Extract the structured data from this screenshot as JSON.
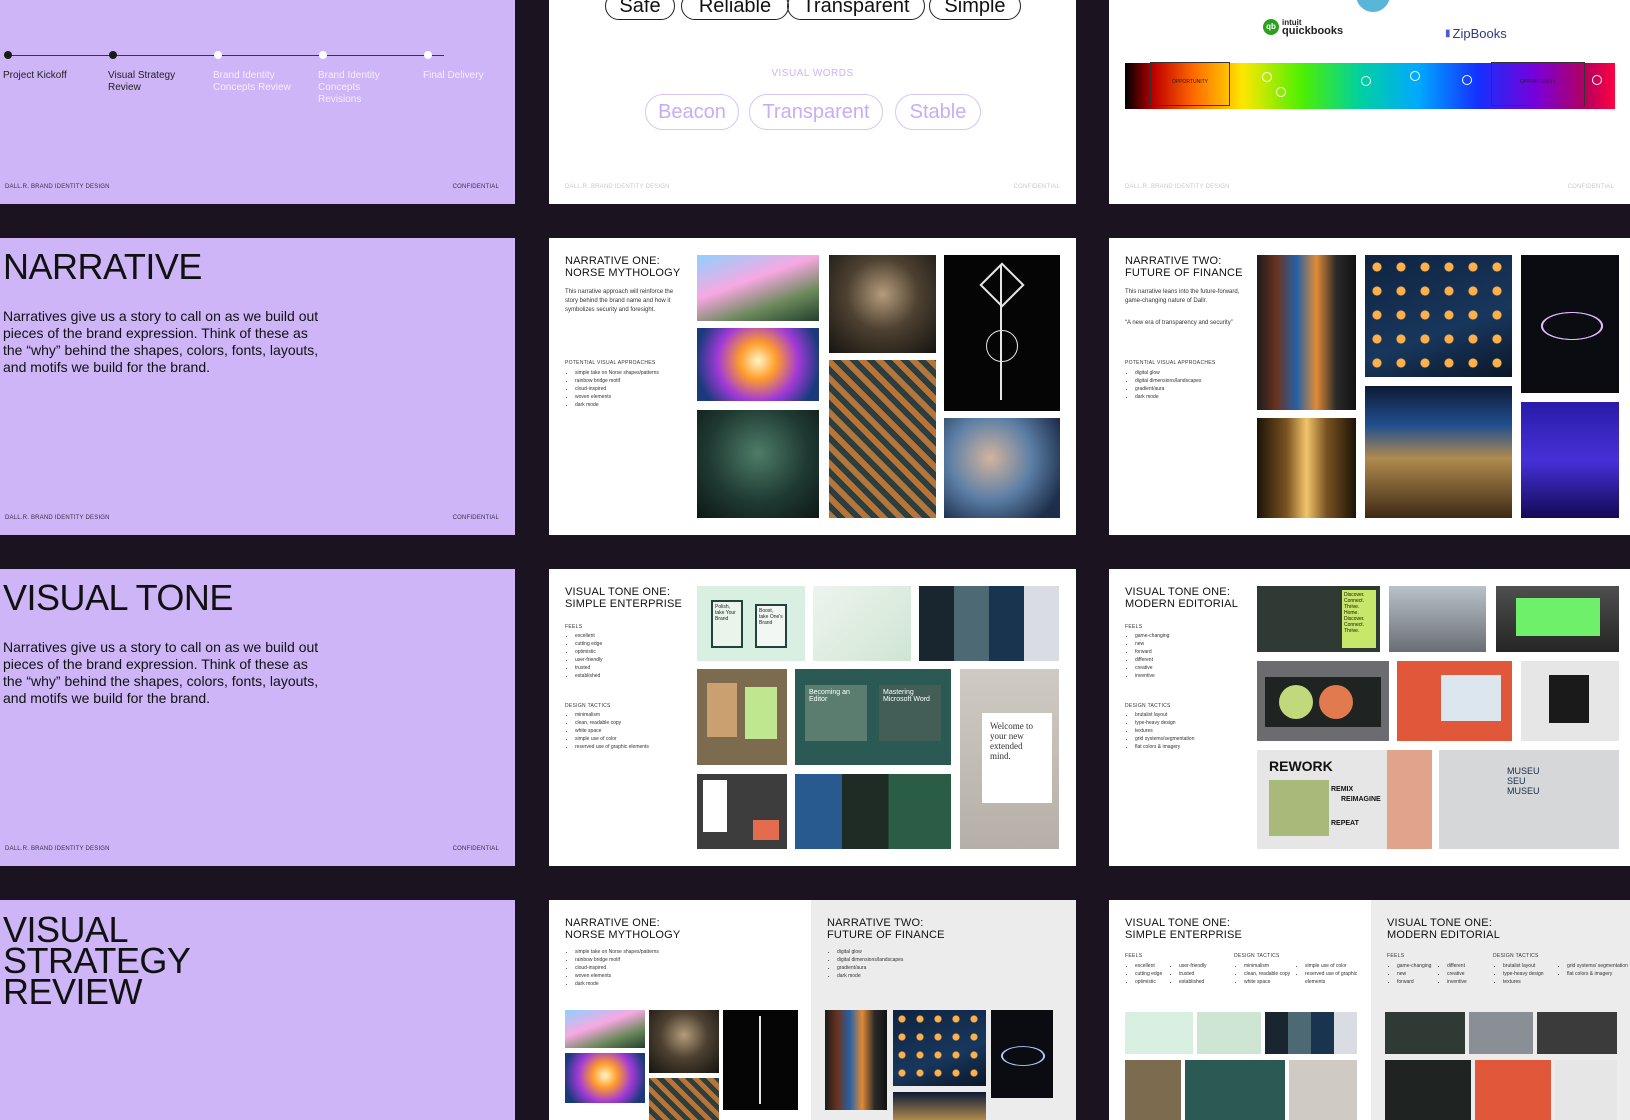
{
  "footer": {
    "left": "DALL.R. BRAND IDENTITY DESIGN",
    "right": "CONFIDENTIAL"
  },
  "timeline": {
    "steps": [
      {
        "label": "Project Kickoff",
        "done": true
      },
      {
        "label": "Visual Strategy Review",
        "done": true
      },
      {
        "label": "Brand Identity Concepts Review",
        "done": false
      },
      {
        "label": "Brand Identity Concepts Revisions",
        "done": false
      },
      {
        "label": "Final Delivery",
        "done": false
      }
    ]
  },
  "words": {
    "top_pills": [
      "Safe",
      "Reliable",
      "Transparent",
      "Simple"
    ],
    "section_label": "VISUAL WORDS",
    "pills": [
      "Beacon",
      "Transparent",
      "Stable"
    ]
  },
  "logos": {
    "quickbooks_brand": "intuit",
    "quickbooks_name": "quickbooks",
    "zipbooks": "ZipBooks",
    "opportunity_left": "OPPORTUNITY",
    "opportunity_right": "OPPORTUNITY"
  },
  "narrative": {
    "title": "NARRATIVE",
    "body": "Narratives give us a story to call on as we build out pieces of the brand expression. Think of these as the “why” behind the shapes, colors, fonts, layouts, and motifs we build for the brand."
  },
  "norse": {
    "title": "NARRATIVE ONE: NORSE MYTHOLOGY",
    "body": "This narrative approach will reinforce the story behind the brand name and how it symbolizes security and foresight.",
    "approach_label": "POTENTIAL VISUAL APPROACHES",
    "approaches": [
      "simple take on Norse shapes/patterns",
      "rainbow bridge motif",
      "cloud-inspired",
      "woven elements",
      "dark mode"
    ]
  },
  "finance": {
    "title": "NARRATIVE TWO: FUTURE OF FINANCE",
    "body": "This narrative leans into the future-forward, game-changing nature of Dallr.",
    "quote": "“A new era of transparency and security”",
    "approach_label": "POTENTIAL VISUAL APPROACHES",
    "approaches": [
      "digital glow",
      "digital dimensions/landscapes",
      "gradient/aura",
      "dark mode"
    ]
  },
  "visual_tone": {
    "title": "VISUAL TONE",
    "body": "Narratives give us a story to call on as we build out pieces of the brand expression. Think of these as the “why” behind the shapes, colors, fonts, layouts, and motifs we build for the brand."
  },
  "enterprise": {
    "title": "VISUAL TONE ONE: SIMPLE ENTERPRISE",
    "feels_label": "FEELS",
    "feels": [
      "excellent",
      "cutting edge",
      "optimistic",
      "user-friendly",
      "trusted",
      "established"
    ],
    "tactics_label": "DESIGN TACTICS",
    "tactics": [
      "minimalism",
      "clean, readable copy",
      "white space",
      "simple use of color",
      "reserved use of graphic elements"
    ],
    "billboard_1": "Polish, take Your Brand",
    "billboard_2": "Boost, take One's Brand",
    "screen_a": "Becoming an Editor",
    "screen_b": "Mastering Microsoft Word",
    "welcome": "Welcome to your new extended mind."
  },
  "editorial": {
    "title": "VISUAL TONE ONE: MODERN EDITORIAL",
    "feels_label": "FEELS",
    "feels": [
      "game-changing",
      "new",
      "forward",
      "different",
      "creative",
      "inventive"
    ],
    "tactics_label": "DESIGN TACTICS",
    "tactics": [
      "brutalist layout",
      "type-heavy design",
      "textures",
      "grid systems/segmentation",
      "flat colors & imagery"
    ],
    "poster_text": "Discover. Connect. Thrive. Home. Discover. Connect. Thrive.",
    "rework": [
      "REWORK",
      "REMIX",
      "REIMAGINE",
      "REPEAT"
    ],
    "museu": "MUSEU SEU MUSEU"
  },
  "strategy": {
    "title": "VISUAL STRATEGY REVIEW"
  },
  "bottom_norse": {
    "title": "NARRATIVE ONE: NORSE MYTHOLOGY",
    "items": [
      "simple take on Norse shapes/patterns",
      "rainbow bridge motif",
      "cloud-inspired",
      "woven elements",
      "dark mode"
    ]
  },
  "bottom_finance": {
    "title": "NARRATIVE TWO: FUTURE OF FINANCE",
    "items": [
      "digital glow",
      "digital dimensions/landscapes",
      "gradient/aura",
      "dark mode"
    ]
  },
  "bottom_enterprise": {
    "title": "VISUAL TONE ONE: SIMPLE ENTERPRISE",
    "feels_label": "FEELS",
    "feels_a": [
      "excellent",
      "cutting edge",
      "optimistic"
    ],
    "feels_b": [
      "user-friendly",
      "trusted",
      "established"
    ],
    "tactics_label": "DESIGN TACTICS",
    "tactics_a": [
      "minimalism",
      "clean, readable copy",
      "white space"
    ],
    "tactics_b": [
      "simple use of color",
      "reserved use of graphic elements"
    ]
  },
  "bottom_editorial": {
    "title": "VISUAL TONE ONE: MODERN EDITORIAL",
    "feels_label": "FEELS",
    "feels_a": [
      "game-changing",
      "new",
      "forward"
    ],
    "feels_b": [
      "different",
      "creative",
      "inventive"
    ],
    "tactics_label": "DESIGN TACTICS",
    "tactics_a": [
      "brutalist layout",
      "type-heavy design",
      "textures"
    ],
    "tactics_b": [
      "grid systems/ segmentation",
      "flat colors & imagery"
    ]
  }
}
